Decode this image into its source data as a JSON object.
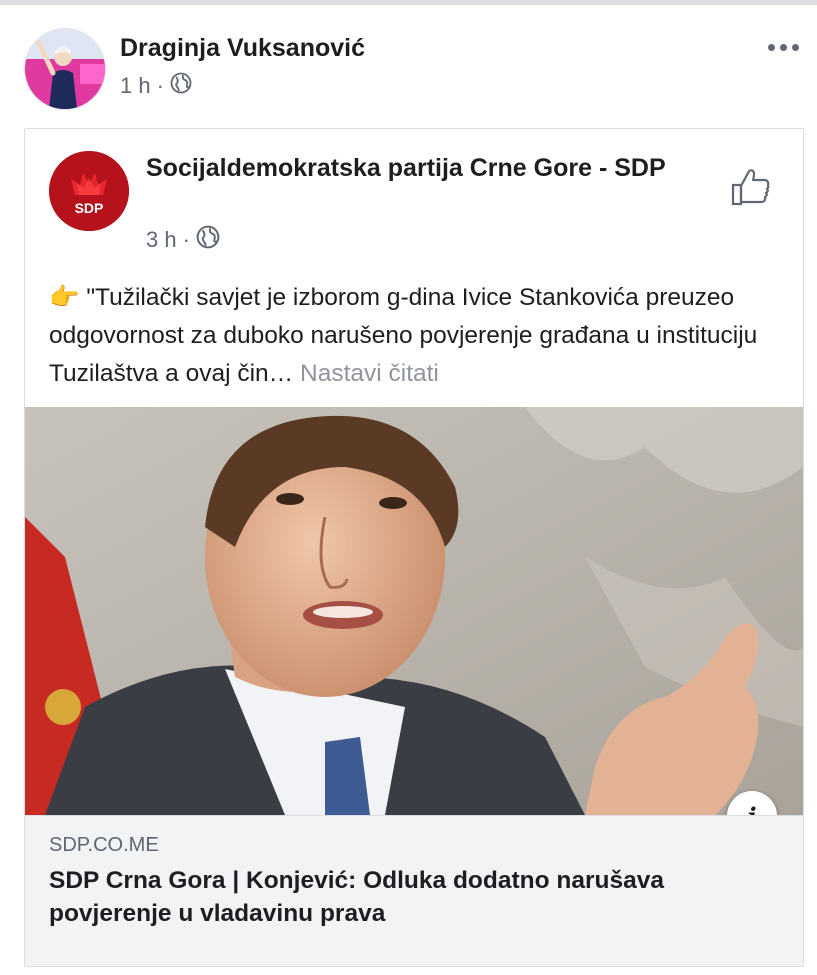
{
  "post": {
    "author": "Draginja Vuksanović",
    "time": "1 h",
    "separator": "·"
  },
  "shared": {
    "page_name": "Socijaldemokratska partija Crne Gore - SDP",
    "logo_text": "SDP",
    "time": "3 h",
    "separator": "·",
    "emoji": "👉",
    "text": "\"Tužilački savjet je izborom g-dina Ivice Stankovića preuzeo odgovornost za duboko narušeno povjerenje građana u instituciju Tuzilaštva a ovaj čin…",
    "see_more": "Nastavi čitati"
  },
  "link": {
    "domain": "SDP.CO.ME",
    "title": "SDP Crna Gora | Konjević: Odluka dodatno narušava povjerenje u vladavinu prava",
    "info_label": "i"
  },
  "icons": {
    "more": "more-dots-icon",
    "globe": "globe-icon",
    "like": "thumbs-up-icon",
    "info": "info-icon"
  },
  "colors": {
    "text": "#1c1e21",
    "secondary": "#606770",
    "see_more": "#90949c",
    "sdp_red": "#b5121b",
    "footer_bg": "#f2f3f5"
  }
}
